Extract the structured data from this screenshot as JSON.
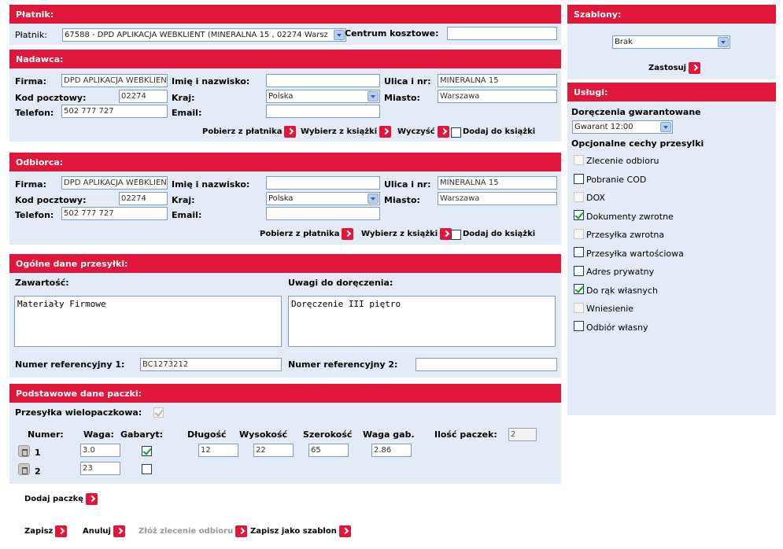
{
  "platnik": {
    "header": "Płatnik:",
    "label": "Płatnik:",
    "value": "67588 - DPD APLIKACJA WEBKLIENT (MINERALNA 15 , 02274 Warsz",
    "cost_center_label": "Centrum kosztowe:",
    "cost_center_value": ""
  },
  "nadawca": {
    "header": "Nadawca:",
    "firma_label": "Firma:",
    "firma": "DPD APLIKACJA WEBKLIENT",
    "imie_label": "Imię i nazwisko:",
    "imie": "",
    "ulica_label": "Ulica i nr:",
    "ulica": "MINERALNA 15",
    "kod_label": "Kod pocztowy:",
    "kod": "02274",
    "kraj_label": "Kraj:",
    "kraj": "Polska",
    "miasto_label": "Miasto:",
    "miasto": "Warszawa",
    "telefon_label": "Telefon:",
    "telefon": "502 777 727",
    "email_label": "Email:",
    "email": "",
    "pobierz": "Pobierz z płatnika",
    "wybierz": "Wybierz z książki",
    "wyczysc": "Wyczyść",
    "dodaj": "Dodaj do książki"
  },
  "odbiorca": {
    "header": "Odbiorca:",
    "firma_label": "Firma:",
    "firma": "DPD APLIKACJA WEBKLIENT",
    "imie_label": "Imię i nazwisko:",
    "imie": "",
    "ulica_label": "Ulica i nr:",
    "ulica": "MINERALNA 15",
    "kod_label": "Kod pocztowy:",
    "kod": "02274",
    "kraj_label": "Kraj:",
    "kraj": "Polska",
    "miasto_label": "Miasto:",
    "miasto": "Warszawa",
    "telefon_label": "Telefon:",
    "telefon": "502 777 727",
    "email_label": "Email:",
    "email": "",
    "pobierz": "Pobierz z płatnika",
    "wybierz": "Wybierz z książki",
    "dodaj": "Dodaj do książki"
  },
  "ogolne": {
    "header": "Ogólne dane przesyłki:",
    "zawartosc_label": "Zawartość:",
    "zawartosc": "Materiały Firmowe",
    "uwagi_label": "Uwagi do doręczenia:",
    "uwagi": "Doręczenie III piętro",
    "ref1_label": "Numer referencyjny 1:",
    "ref1": "BC1273212",
    "ref2_label": "Numer referencyjny 2:",
    "ref2": ""
  },
  "paczki": {
    "header": "Podstawowe dane paczki:",
    "wielo_label": "Przesyłka wielopaczkowa:",
    "wielo_checked": true,
    "col_numer": "Numer:",
    "col_waga": "Waga:",
    "col_gabaryt": "Gabaryt:",
    "col_dlugosc": "Długość",
    "col_wysokosc": "Wysokość",
    "col_szerokosc": "Szerokość",
    "col_waga_gab": "Waga gab.",
    "ilosc_label": "Ilość paczek:",
    "ilosc": "2",
    "rows": [
      {
        "num": "1",
        "waga": "3.0",
        "gabaryt": true,
        "dlugosc": "12",
        "wysokosc": "22",
        "szerokosc": "65",
        "waga_gab": "2.86"
      },
      {
        "num": "2",
        "waga": "23",
        "gabaryt": false
      }
    ]
  },
  "bottom": {
    "dodaj_paczke": "Dodaj paczkę",
    "zapisz": "Zapisz",
    "anuluj": "Anuluj",
    "zloz": "Złóż zlecenie odbioru",
    "zapisz_szablon": "Zapisz jako szablon"
  },
  "szablony": {
    "header": "Szablony:",
    "selected": "Brak",
    "zastosuj": "Zastosuj"
  },
  "uslugi": {
    "header": "Usługi:",
    "gwarant_label": "Doręczenia gwarantowane",
    "gwarant": "Gwarant 12:00",
    "opcjonalne_label": "Opcjonalne cechy przesylki",
    "options": [
      {
        "label": "Zlecenie odbioru",
        "checked": false,
        "disabled": true
      },
      {
        "label": "Pobranie COD",
        "checked": false,
        "disabled": false
      },
      {
        "label": "DOX",
        "checked": false,
        "disabled": true
      },
      {
        "label": "Dokumenty zwrotne",
        "checked": true,
        "disabled": false
      },
      {
        "label": "Przesyłka zwrotna",
        "checked": false,
        "disabled": true
      },
      {
        "label": "Przesyłka wartościowa",
        "checked": false,
        "disabled": false
      },
      {
        "label": "Adres prywatny",
        "checked": false,
        "disabled": false
      },
      {
        "label": "Do rąk własnych",
        "checked": true,
        "disabled": false
      },
      {
        "label": "Wniesienie",
        "checked": false,
        "disabled": true
      },
      {
        "label": "Odbiór własny",
        "checked": false,
        "disabled": false
      }
    ]
  },
  "colors": {
    "accent": "#e0173a",
    "panel": "#e2ebf6"
  }
}
